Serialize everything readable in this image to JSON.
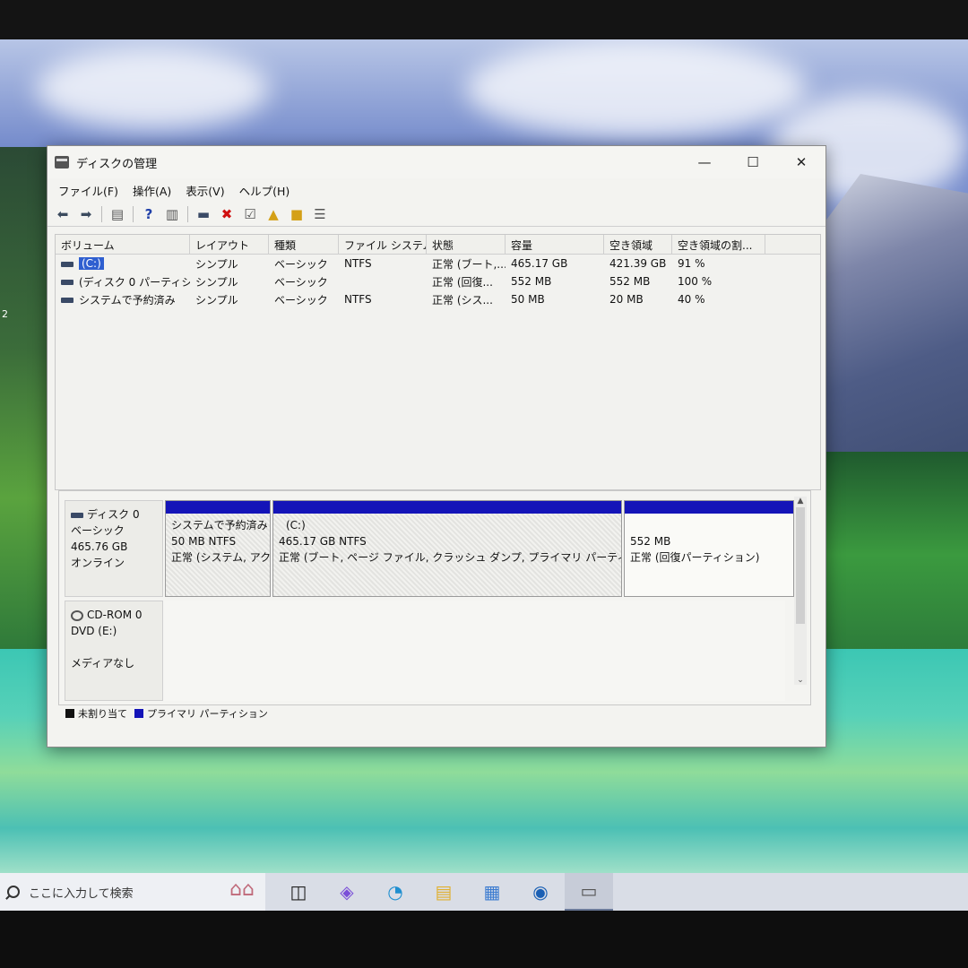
{
  "window": {
    "title": "ディスクの管理",
    "controls": {
      "minimize": "—",
      "maximize": "☐",
      "close": "✕"
    }
  },
  "menu": [
    "ファイル(F)",
    "操作(A)",
    "表示(V)",
    "ヘルプ(H)"
  ],
  "volume_table": {
    "headers": [
      "ボリューム",
      "レイアウト",
      "種類",
      "ファイル システム",
      "状態",
      "容量",
      "空き領域",
      "空き領域の割..."
    ],
    "rows": [
      [
        "(C:)",
        "シンプル",
        "ベーシック",
        "NTFS",
        "正常 (ブート,...",
        "465.17 GB",
        "421.39 GB",
        "91 %"
      ],
      [
        "(ディスク 0 パーティショ...",
        "シンプル",
        "ベーシック",
        "",
        "正常 (回復...",
        "552 MB",
        "552 MB",
        "100 %"
      ],
      [
        "システムで予約済み",
        "シンプル",
        "ベーシック",
        "NTFS",
        "正常 (シス...",
        "50 MB",
        "20 MB",
        "40 %"
      ]
    ]
  },
  "disks": [
    {
      "label": [
        "ディスク 0",
        "ベーシック",
        "465.76 GB",
        "オンライン"
      ],
      "partitions": [
        {
          "lines": [
            "システムで予約済み",
            "50 MB NTFS",
            "正常 (システム, アク"
          ]
        },
        {
          "lines": [
            "(C:)",
            "465.17 GB NTFS",
            "正常 (ブート, ページ ファイル, クラッシュ ダンプ, プライマリ パーティション)"
          ]
        },
        {
          "lines": [
            "",
            "552 MB",
            "正常 (回復パーティション)"
          ]
        }
      ]
    },
    {
      "label": [
        "CD-ROM 0",
        "DVD (E:)",
        "",
        "メディアなし"
      ]
    }
  ],
  "legend": {
    "unallocated": "未割り当て",
    "primary": "プライマリ パーティション"
  },
  "colors": {
    "primary_partition": "#1414b8",
    "unallocated": "#111111",
    "selection": "#2f5fd0"
  },
  "desktop_label": "2",
  "taskbar": {
    "search_placeholder": "ここに入力して検索",
    "icons": [
      "task-view-icon",
      "copilot-icon",
      "edge-icon",
      "file-explorer-icon",
      "store-icon",
      "outlook-icon",
      "disk-management-icon"
    ]
  }
}
